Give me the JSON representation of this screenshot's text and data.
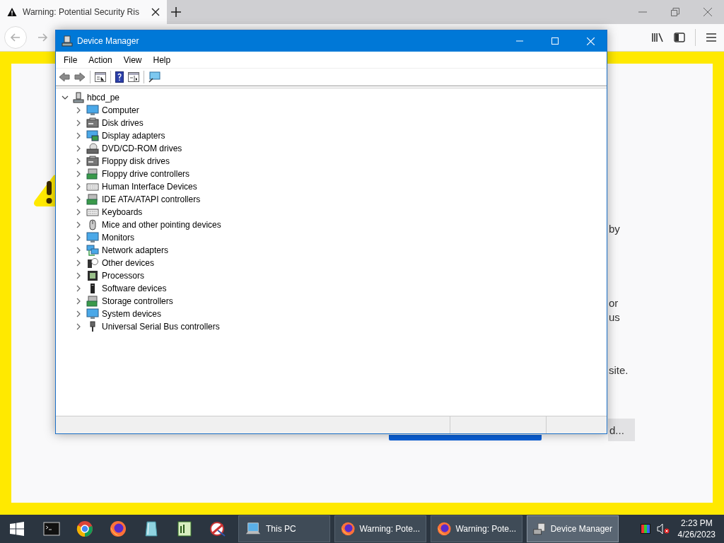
{
  "browser": {
    "tab": {
      "title": "Warning: Potential Security Ris",
      "selected": true
    },
    "page_fragments": [
      {
        "text": "by"
      },
      {
        "text": "or"
      },
      {
        "text": "us"
      },
      {
        "text": "site."
      }
    ],
    "page_button": {
      "label": "d..."
    }
  },
  "device_manager": {
    "title": "Device Manager",
    "menu": [
      "File",
      "Action",
      "View",
      "Help"
    ],
    "tree": {
      "label": "hbcd_pe",
      "expanded": true,
      "children": [
        {
          "label": "Computer",
          "kind": "computer",
          "expanded": false
        },
        {
          "label": "Disk drives",
          "kind": "disk",
          "expanded": false
        },
        {
          "label": "Display adapters",
          "kind": "display",
          "expanded": false
        },
        {
          "label": "DVD/CD-ROM drives",
          "kind": "dvd",
          "expanded": false
        },
        {
          "label": "Floppy disk drives",
          "kind": "floppy",
          "expanded": false
        },
        {
          "label": "Floppy drive controllers",
          "kind": "controller",
          "expanded": false
        },
        {
          "label": "Human Interface Devices",
          "kind": "hid",
          "expanded": false
        },
        {
          "label": "IDE ATA/ATAPI controllers",
          "kind": "controller",
          "expanded": false
        },
        {
          "label": "Keyboards",
          "kind": "keyboard",
          "expanded": false
        },
        {
          "label": "Mice and other pointing devices",
          "kind": "mouse",
          "expanded": false
        },
        {
          "label": "Monitors",
          "kind": "monitor",
          "expanded": false
        },
        {
          "label": "Network adapters",
          "kind": "network",
          "expanded": false
        },
        {
          "label": "Other devices",
          "kind": "other",
          "expanded": false
        },
        {
          "label": "Processors",
          "kind": "cpu",
          "expanded": false
        },
        {
          "label": "Software devices",
          "kind": "software",
          "expanded": false
        },
        {
          "label": "Storage controllers",
          "kind": "storage",
          "expanded": false
        },
        {
          "label": "System devices",
          "kind": "system",
          "expanded": false
        },
        {
          "label": "Universal Serial Bus controllers",
          "kind": "usb",
          "expanded": false
        }
      ]
    }
  },
  "taskbar": {
    "pinned": [
      {
        "kind": "terminal"
      },
      {
        "kind": "globe"
      },
      {
        "kind": "fox"
      },
      {
        "kind": "glass"
      },
      {
        "kind": "notepad"
      },
      {
        "kind": "tool"
      }
    ],
    "tasks": [
      {
        "label": "This PC",
        "kind": "pc",
        "selected": false
      },
      {
        "label": "Warning: Pote...",
        "kind": "fox",
        "selected": false
      },
      {
        "label": "Warning: Pote...",
        "kind": "fox",
        "selected": false
      },
      {
        "label": "Device Manager",
        "kind": "devmgr",
        "selected": true
      }
    ],
    "time": "2:23 PM",
    "date": "4/26/2023"
  }
}
